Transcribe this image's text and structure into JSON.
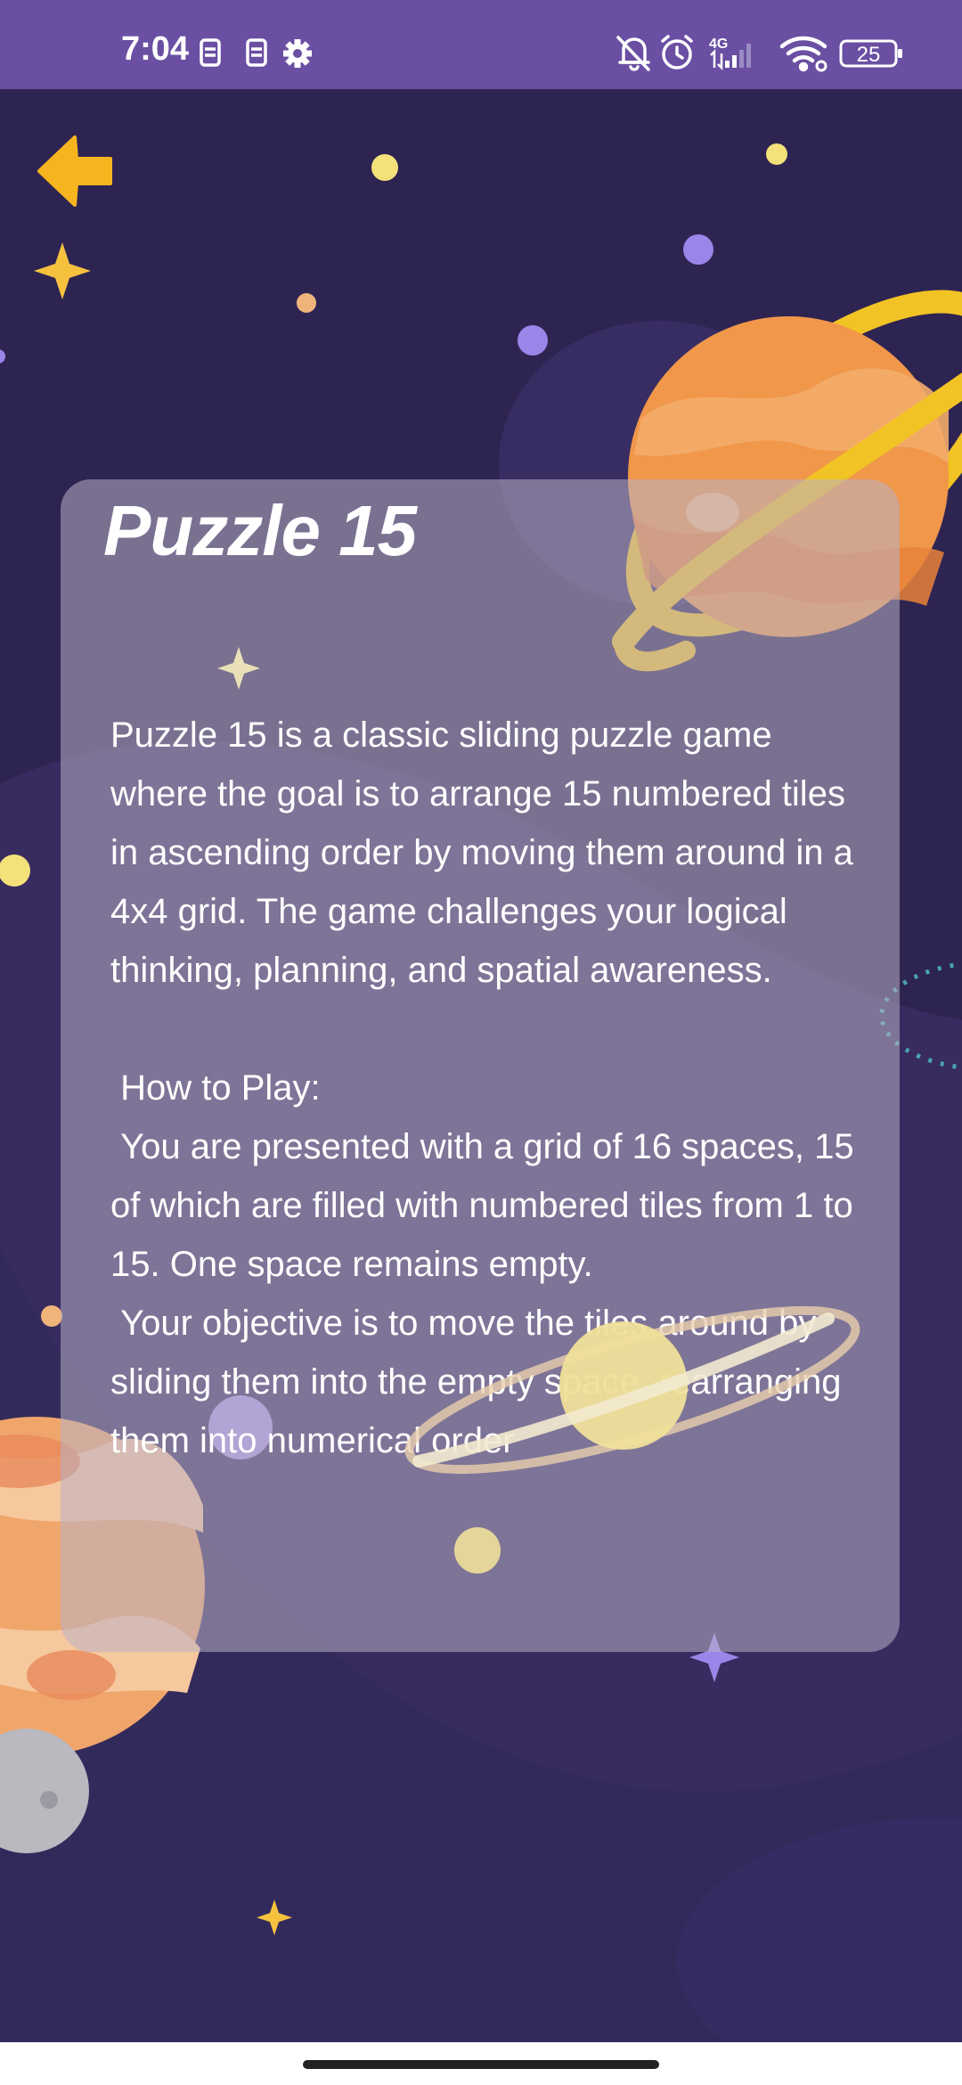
{
  "status_bar": {
    "time": "7:04",
    "network": "4G",
    "battery": "25"
  },
  "icons": {
    "back": "arrow-left-icon",
    "status_left": [
      "sim-icon",
      "sim-icon",
      "gear-icon"
    ],
    "status_right": [
      "bell-off-icon",
      "alarm-icon",
      "signal-icon",
      "wifi-icon",
      "battery-icon"
    ]
  },
  "colors": {
    "status_bar": "#6a4fa3",
    "background": "#2e2452",
    "accent_yellow": "#f6b51e",
    "card_overlay": "#bab0c4",
    "text": "#ffffff"
  },
  "card": {
    "title": "Puzzle 15",
    "body": "Puzzle 15 is a classic sliding puzzle game where the goal is to arrange 15 numbered tiles in ascending order by moving them around in a 4x4 grid. The game challenges your logical thinking, planning, and spatial awareness.\n\n How to Play:\n You are presented with a grid of 16 spaces, 15 of which are filled with numbered tiles from 1 to 15. One space remains empty.\n Your objective is to move the tiles around by sliding them into the empty space, rearranging them into numerical order"
  }
}
